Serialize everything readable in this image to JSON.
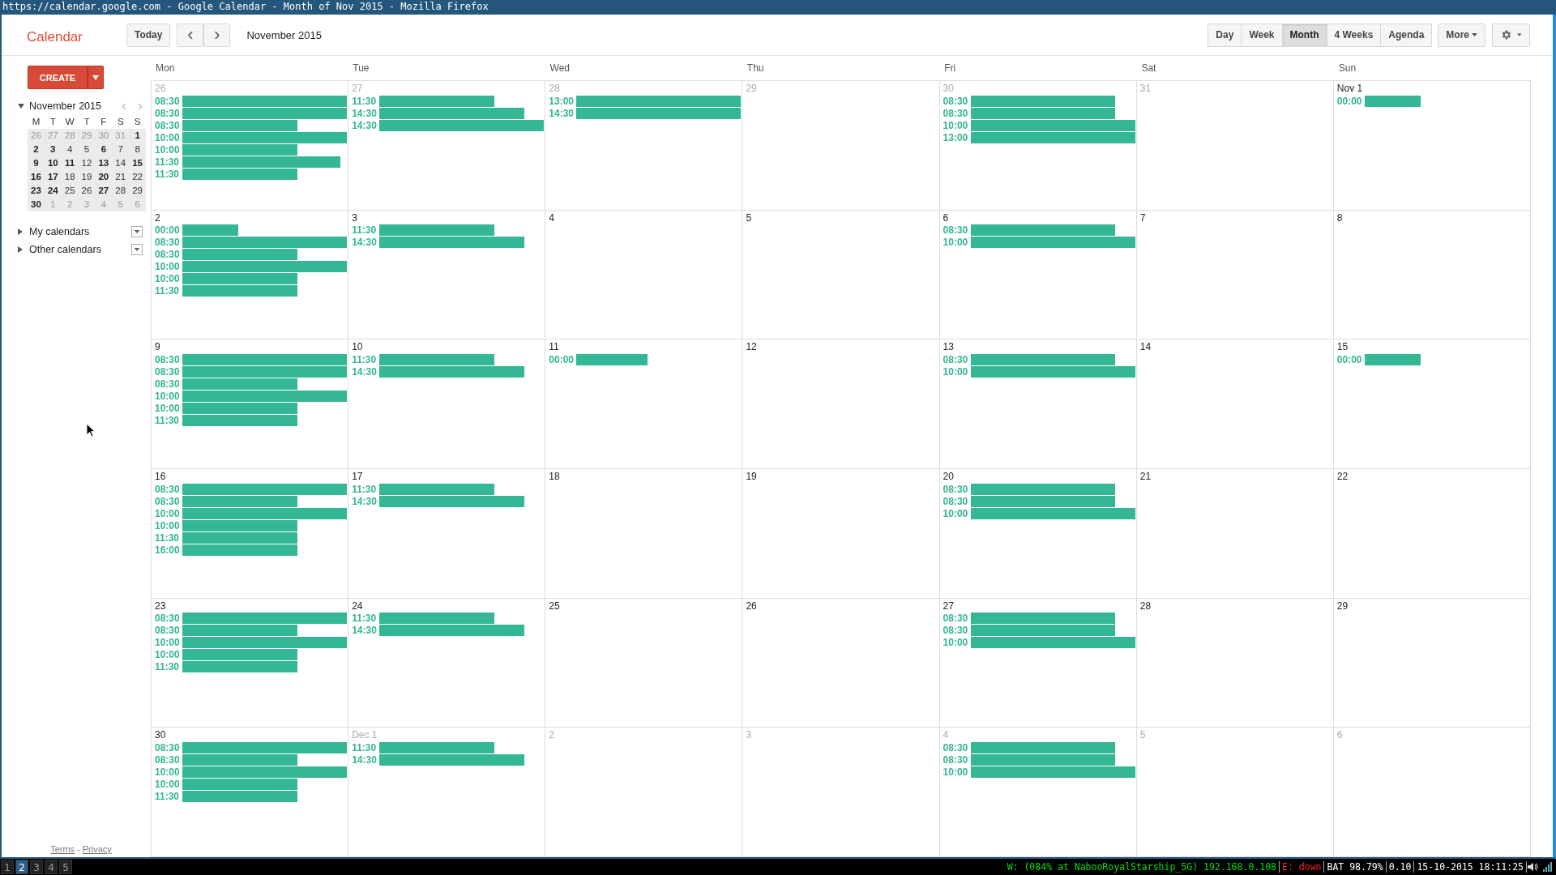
{
  "window": {
    "title": "https://calendar.google.com - Google Calendar - Month of Nov 2015 - Mozilla Firefox"
  },
  "header": {
    "logo": "Calendar",
    "today": "Today",
    "prev": "‹",
    "next": "›",
    "period": "November 2015",
    "views": [
      {
        "label": "Day",
        "selected": false
      },
      {
        "label": "Week",
        "selected": false
      },
      {
        "label": "Month",
        "selected": true
      },
      {
        "label": "4 Weeks",
        "selected": false
      },
      {
        "label": "Agenda",
        "selected": false
      }
    ],
    "more": "More"
  },
  "sidebar": {
    "create": "CREATE",
    "mini_calendar": {
      "title": "November 2015",
      "weekdays": [
        "M",
        "T",
        "W",
        "T",
        "F",
        "S",
        "S"
      ],
      "weeks": [
        [
          {
            "day": "26",
            "bold": false,
            "other_month": true
          },
          {
            "day": "27",
            "bold": false,
            "other_month": true
          },
          {
            "day": "28",
            "bold": false,
            "other_month": true
          },
          {
            "day": "29",
            "bold": false,
            "other_month": true
          },
          {
            "day": "30",
            "bold": false,
            "other_month": true
          },
          {
            "day": "31",
            "bold": false,
            "other_month": true
          },
          {
            "day": "1",
            "bold": true,
            "other_month": false
          }
        ],
        [
          {
            "day": "2",
            "bold": true,
            "other_month": false
          },
          {
            "day": "3",
            "bold": true,
            "other_month": false
          },
          {
            "day": "4",
            "bold": false,
            "other_month": false
          },
          {
            "day": "5",
            "bold": false,
            "other_month": false
          },
          {
            "day": "6",
            "bold": true,
            "other_month": false
          },
          {
            "day": "7",
            "bold": false,
            "other_month": false
          },
          {
            "day": "8",
            "bold": false,
            "other_month": false
          }
        ],
        [
          {
            "day": "9",
            "bold": true,
            "other_month": false
          },
          {
            "day": "10",
            "bold": true,
            "other_month": false
          },
          {
            "day": "11",
            "bold": true,
            "other_month": false
          },
          {
            "day": "12",
            "bold": false,
            "other_month": false
          },
          {
            "day": "13",
            "bold": true,
            "other_month": false
          },
          {
            "day": "14",
            "bold": false,
            "other_month": false
          },
          {
            "day": "15",
            "bold": true,
            "other_month": false
          }
        ],
        [
          {
            "day": "16",
            "bold": true,
            "other_month": false
          },
          {
            "day": "17",
            "bold": true,
            "other_month": false
          },
          {
            "day": "18",
            "bold": false,
            "other_month": false
          },
          {
            "day": "19",
            "bold": false,
            "other_month": false
          },
          {
            "day": "20",
            "bold": true,
            "other_month": false
          },
          {
            "day": "21",
            "bold": false,
            "other_month": false
          },
          {
            "day": "22",
            "bold": false,
            "other_month": false
          }
        ],
        [
          {
            "day": "23",
            "bold": true,
            "other_month": false
          },
          {
            "day": "24",
            "bold": true,
            "other_month": false
          },
          {
            "day": "25",
            "bold": false,
            "other_month": false
          },
          {
            "day": "26",
            "bold": false,
            "other_month": false
          },
          {
            "day": "27",
            "bold": true,
            "other_month": false
          },
          {
            "day": "28",
            "bold": false,
            "other_month": false
          },
          {
            "day": "29",
            "bold": false,
            "other_month": false
          }
        ],
        [
          {
            "day": "30",
            "bold": true,
            "other_month": false
          },
          {
            "day": "1",
            "bold": false,
            "other_month": true
          },
          {
            "day": "2",
            "bold": false,
            "other_month": true
          },
          {
            "day": "3",
            "bold": false,
            "other_month": true
          },
          {
            "day": "4",
            "bold": false,
            "other_month": true
          },
          {
            "day": "5",
            "bold": false,
            "other_month": true
          },
          {
            "day": "6",
            "bold": false,
            "other_month": true
          }
        ]
      ]
    },
    "calendar_groups": [
      {
        "label": "My calendars",
        "expanded": false
      },
      {
        "label": "Other calendars",
        "expanded": false
      }
    ],
    "footer_links": [
      "Terms",
      "Privacy"
    ],
    "footer_separator": "-"
  },
  "month": {
    "weekdays": [
      "Mon",
      "Tue",
      "Wed",
      "Thu",
      "Fri",
      "Sat",
      "Sun"
    ],
    "weeks": [
      [
        {
          "date": "26",
          "other_month": true,
          "events": [
            {
              "time": "08:30",
              "kind": "full"
            },
            {
              "time": "08:30",
              "kind": "full"
            },
            {
              "time": "08:30",
              "kind": "short"
            },
            {
              "time": "10:00",
              "kind": "full"
            },
            {
              "time": "10:00",
              "kind": "short"
            },
            {
              "time": "11:30",
              "kind": "long"
            },
            {
              "time": "11:30",
              "kind": "short"
            }
          ]
        },
        {
          "date": "27",
          "other_month": true,
          "events": [
            {
              "time": "11:30",
              "kind": "short"
            },
            {
              "time": "14:30",
              "kind": "medium"
            },
            {
              "time": "14:30",
              "kind": "full"
            }
          ]
        },
        {
          "date": "28",
          "other_month": true,
          "events": [
            {
              "time": "13:00",
              "kind": "full"
            },
            {
              "time": "14:30",
              "kind": "full"
            }
          ]
        },
        {
          "date": "29",
          "other_month": true
        },
        {
          "date": "30",
          "other_month": true,
          "events": [
            {
              "time": "08:30",
              "kind": "medium"
            },
            {
              "time": "08:30",
              "kind": "medium"
            },
            {
              "time": "10:00",
              "kind": "full"
            },
            {
              "time": "13:00",
              "kind": "full"
            }
          ]
        },
        {
          "date": "31",
          "other_month": true
        },
        {
          "date": "Nov 1",
          "other_month": false,
          "events": [
            {
              "time": "00:00",
              "kind": "tiny"
            }
          ]
        }
      ],
      [
        {
          "date": "2",
          "other_month": false,
          "events": [
            {
              "time": "00:00",
              "kind": "tiny"
            },
            {
              "time": "08:30",
              "kind": "full"
            },
            {
              "time": "08:30",
              "kind": "short"
            },
            {
              "time": "10:00",
              "kind": "full"
            },
            {
              "time": "10:00",
              "kind": "short"
            },
            {
              "time": "11:30",
              "kind": "short"
            }
          ]
        },
        {
          "date": "3",
          "other_month": false,
          "events": [
            {
              "time": "11:30",
              "kind": "short"
            },
            {
              "time": "14:30",
              "kind": "medium"
            }
          ]
        },
        {
          "date": "4",
          "other_month": false
        },
        {
          "date": "5",
          "other_month": false
        },
        {
          "date": "6",
          "other_month": false,
          "events": [
            {
              "time": "08:30",
              "kind": "medium"
            },
            {
              "time": "10:00",
              "kind": "full"
            }
          ]
        },
        {
          "date": "7",
          "other_month": false
        },
        {
          "date": "8",
          "other_month": false
        }
      ],
      [
        {
          "date": "9",
          "other_month": false,
          "events": [
            {
              "time": "08:30",
              "kind": "full"
            },
            {
              "time": "08:30",
              "kind": "full"
            },
            {
              "time": "08:30",
              "kind": "short"
            },
            {
              "time": "10:00",
              "kind": "full"
            },
            {
              "time": "10:00",
              "kind": "short"
            },
            {
              "time": "11:30",
              "kind": "short"
            }
          ]
        },
        {
          "date": "10",
          "other_month": false,
          "events": [
            {
              "time": "11:30",
              "kind": "short"
            },
            {
              "time": "14:30",
              "kind": "medium"
            }
          ]
        },
        {
          "date": "11",
          "other_month": false,
          "events": [
            {
              "time": "00:00",
              "kind": "small"
            }
          ]
        },
        {
          "date": "12",
          "other_month": false
        },
        {
          "date": "13",
          "other_month": false,
          "events": [
            {
              "time": "08:30",
              "kind": "medium"
            },
            {
              "time": "10:00",
              "kind": "full"
            }
          ]
        },
        {
          "date": "14",
          "other_month": false
        },
        {
          "date": "15",
          "other_month": false,
          "events": [
            {
              "time": "00:00",
              "kind": "tiny"
            }
          ]
        }
      ],
      [
        {
          "date": "16",
          "other_month": false,
          "events": [
            {
              "time": "08:30",
              "kind": "full"
            },
            {
              "time": "08:30",
              "kind": "short"
            },
            {
              "time": "10:00",
              "kind": "full"
            },
            {
              "time": "10:00",
              "kind": "short"
            },
            {
              "time": "11:30",
              "kind": "short"
            },
            {
              "time": "16:00",
              "kind": "short"
            }
          ]
        },
        {
          "date": "17",
          "other_month": false,
          "events": [
            {
              "time": "11:30",
              "kind": "short"
            },
            {
              "time": "14:30",
              "kind": "medium"
            }
          ]
        },
        {
          "date": "18",
          "other_month": false
        },
        {
          "date": "19",
          "other_month": false
        },
        {
          "date": "20",
          "other_month": false,
          "events": [
            {
              "time": "08:30",
              "kind": "medium"
            },
            {
              "time": "08:30",
              "kind": "medium"
            },
            {
              "time": "10:00",
              "kind": "full"
            }
          ]
        },
        {
          "date": "21",
          "other_month": false
        },
        {
          "date": "22",
          "other_month": false
        }
      ],
      [
        {
          "date": "23",
          "other_month": false,
          "events": [
            {
              "time": "08:30",
              "kind": "full"
            },
            {
              "time": "08:30",
              "kind": "short"
            },
            {
              "time": "10:00",
              "kind": "full"
            },
            {
              "time": "10:00",
              "kind": "short"
            },
            {
              "time": "11:30",
              "kind": "short"
            }
          ]
        },
        {
          "date": "24",
          "other_month": false,
          "events": [
            {
              "time": "11:30",
              "kind": "short"
            },
            {
              "time": "14:30",
              "kind": "medium"
            }
          ]
        },
        {
          "date": "25",
          "other_month": false
        },
        {
          "date": "26",
          "other_month": false
        },
        {
          "date": "27",
          "other_month": false,
          "events": [
            {
              "time": "08:30",
              "kind": "medium"
            },
            {
              "time": "08:30",
              "kind": "medium"
            },
            {
              "time": "10:00",
              "kind": "full"
            }
          ]
        },
        {
          "date": "28",
          "other_month": false
        },
        {
          "date": "29",
          "other_month": false
        }
      ],
      [
        {
          "date": "30",
          "other_month": false,
          "events": [
            {
              "time": "08:30",
              "kind": "full"
            },
            {
              "time": "08:30",
              "kind": "short"
            },
            {
              "time": "10:00",
              "kind": "full"
            },
            {
              "time": "10:00",
              "kind": "short"
            },
            {
              "time": "11:30",
              "kind": "short"
            }
          ]
        },
        {
          "date": "Dec 1",
          "other_month": true,
          "events": [
            {
              "time": "11:30",
              "kind": "short"
            },
            {
              "time": "14:30",
              "kind": "medium"
            }
          ]
        },
        {
          "date": "2",
          "other_month": true
        },
        {
          "date": "3",
          "other_month": true
        },
        {
          "date": "4",
          "other_month": true,
          "events": [
            {
              "time": "08:30",
              "kind": "medium"
            },
            {
              "time": "08:30",
              "kind": "medium"
            },
            {
              "time": "10:00",
              "kind": "full"
            }
          ]
        },
        {
          "date": "5",
          "other_month": true
        },
        {
          "date": "6",
          "other_month": true
        }
      ]
    ]
  },
  "status_bar": {
    "workspaces": [
      {
        "label": "1",
        "selected": false
      },
      {
        "label": "2",
        "selected": true
      },
      {
        "label": "3",
        "selected": false
      },
      {
        "label": "4",
        "selected": false
      },
      {
        "label": "5",
        "selected": false
      }
    ],
    "segments": [
      {
        "text": "W: (084% at NabooRoyalStarship_5G) 192.168.0.108",
        "color": "#00e000"
      },
      {
        "text": "E: down",
        "color": "#ff2020"
      },
      {
        "text": "BAT 98.79%",
        "color": "#ffffff"
      },
      {
        "text": "0.10",
        "color": "#ffffff"
      },
      {
        "text": "15-10-2015 18:11:25",
        "color": "#ffffff"
      }
    ]
  }
}
